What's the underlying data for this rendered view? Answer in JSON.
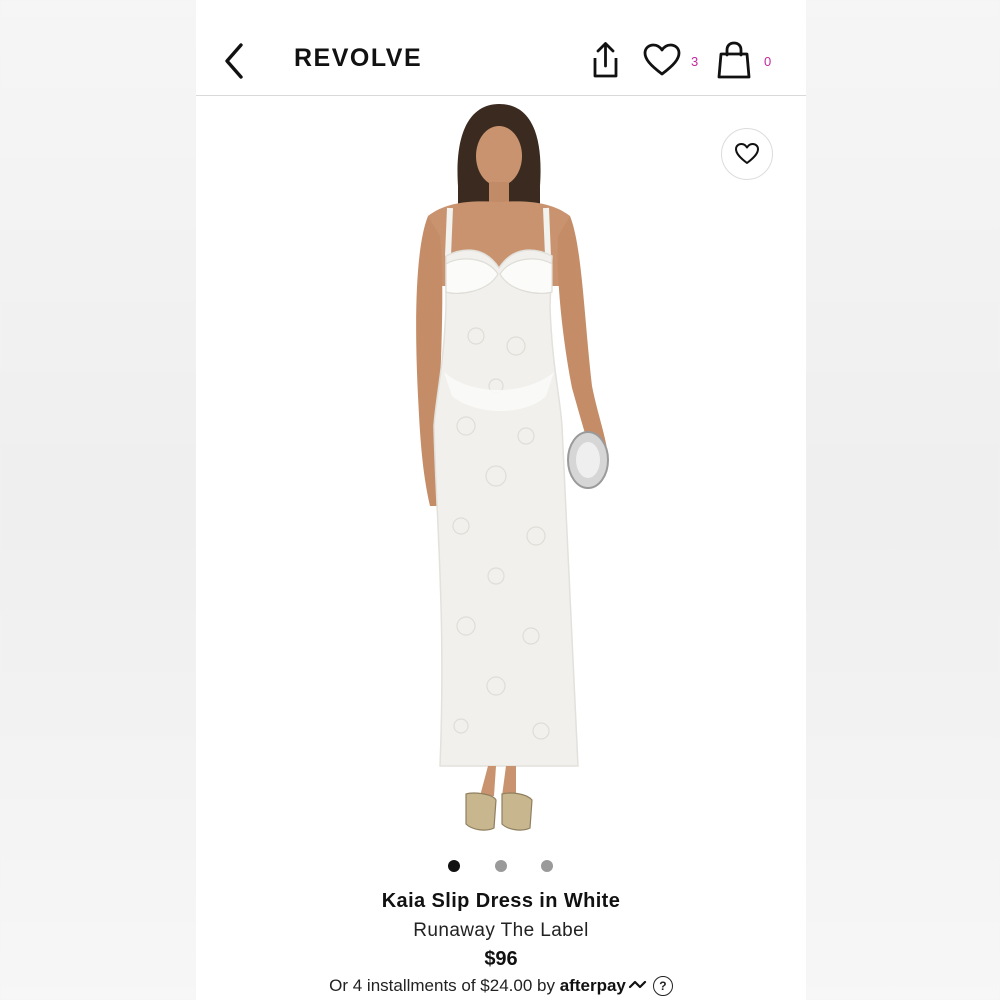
{
  "header": {
    "brand": "REVOLVE",
    "wishlist_count": "3",
    "bag_count": "0"
  },
  "carousel": {
    "slides": 3,
    "active_index": 0
  },
  "product": {
    "title": "Kaia Slip Dress in White",
    "brand": "Runaway The Label",
    "price": "$96",
    "installments_text": "Or 4 installments of $24.00 by",
    "afterpay_label": "afterpay",
    "help_symbol": "?"
  },
  "colors": {
    "accent_count": "#c0299f",
    "dot_active": "#111111",
    "dot_inactive": "#9a9a9a"
  }
}
